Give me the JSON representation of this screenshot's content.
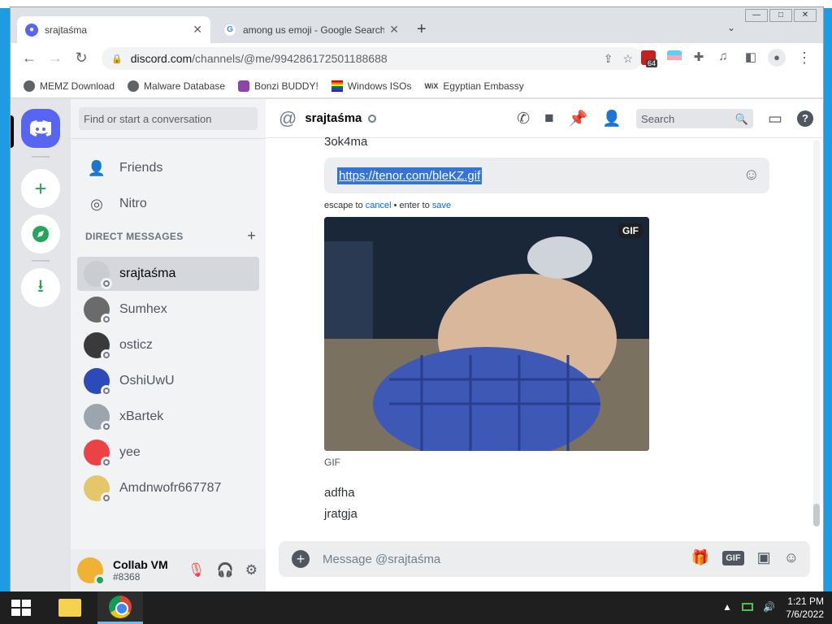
{
  "browser": {
    "tabs": [
      {
        "title": "srajtaśma",
        "favicon": "discord-icon"
      },
      {
        "title": "among us emoji - Google Search",
        "favicon": "google-icon"
      }
    ],
    "new_tab": "+",
    "url_host": "discord.com",
    "url_path": "/channels/@me/994286172501188688",
    "extension_badge": "64",
    "bookmarks": [
      {
        "label": "MEMZ Download"
      },
      {
        "label": "Malware Database"
      },
      {
        "label": "Bonzi BUDDY!"
      },
      {
        "label": "Windows ISOs"
      },
      {
        "label": "Egyptian Embassy"
      }
    ]
  },
  "sidebar": {
    "search_placeholder": "Find or start a conversation",
    "friends_label": "Friends",
    "nitro_label": "Nitro",
    "dm_header": "DIRECT MESSAGES",
    "dms": [
      {
        "name": "srajtaśma",
        "color": "#c9ccd1",
        "active": true
      },
      {
        "name": "Sumhex",
        "color": "#6b6b6b"
      },
      {
        "name": "osticz",
        "color": "#3a3a3a"
      },
      {
        "name": "OshiUwU",
        "color": "#2d4bb8"
      },
      {
        "name": "xBartek",
        "color": "#9aa5ae"
      },
      {
        "name": "yee",
        "color": "#ed4245"
      },
      {
        "name": "Amdnwofr667787",
        "color": "#e6c66a"
      }
    ]
  },
  "user": {
    "name": "Collab VM",
    "tag": "#8368"
  },
  "chat": {
    "recipient": "srajtaśma",
    "search_placeholder": "Search",
    "prev_message": "3ok4ma",
    "edit_text": "https://tenor.com/bleKZ.gif",
    "edit_hint_prefix": "escape to",
    "edit_hint_cancel": "cancel",
    "edit_hint_middle": "• enter to",
    "edit_hint_save": "save",
    "gif_badge": "GIF",
    "gif_caption": "GIF",
    "messages": [
      "adfha",
      "jratgja"
    ],
    "composer_placeholder": "Message @srajtaśma",
    "gif_button": "GIF"
  },
  "taskbar": {
    "time": "1:21 PM",
    "date": "7/6/2022"
  }
}
